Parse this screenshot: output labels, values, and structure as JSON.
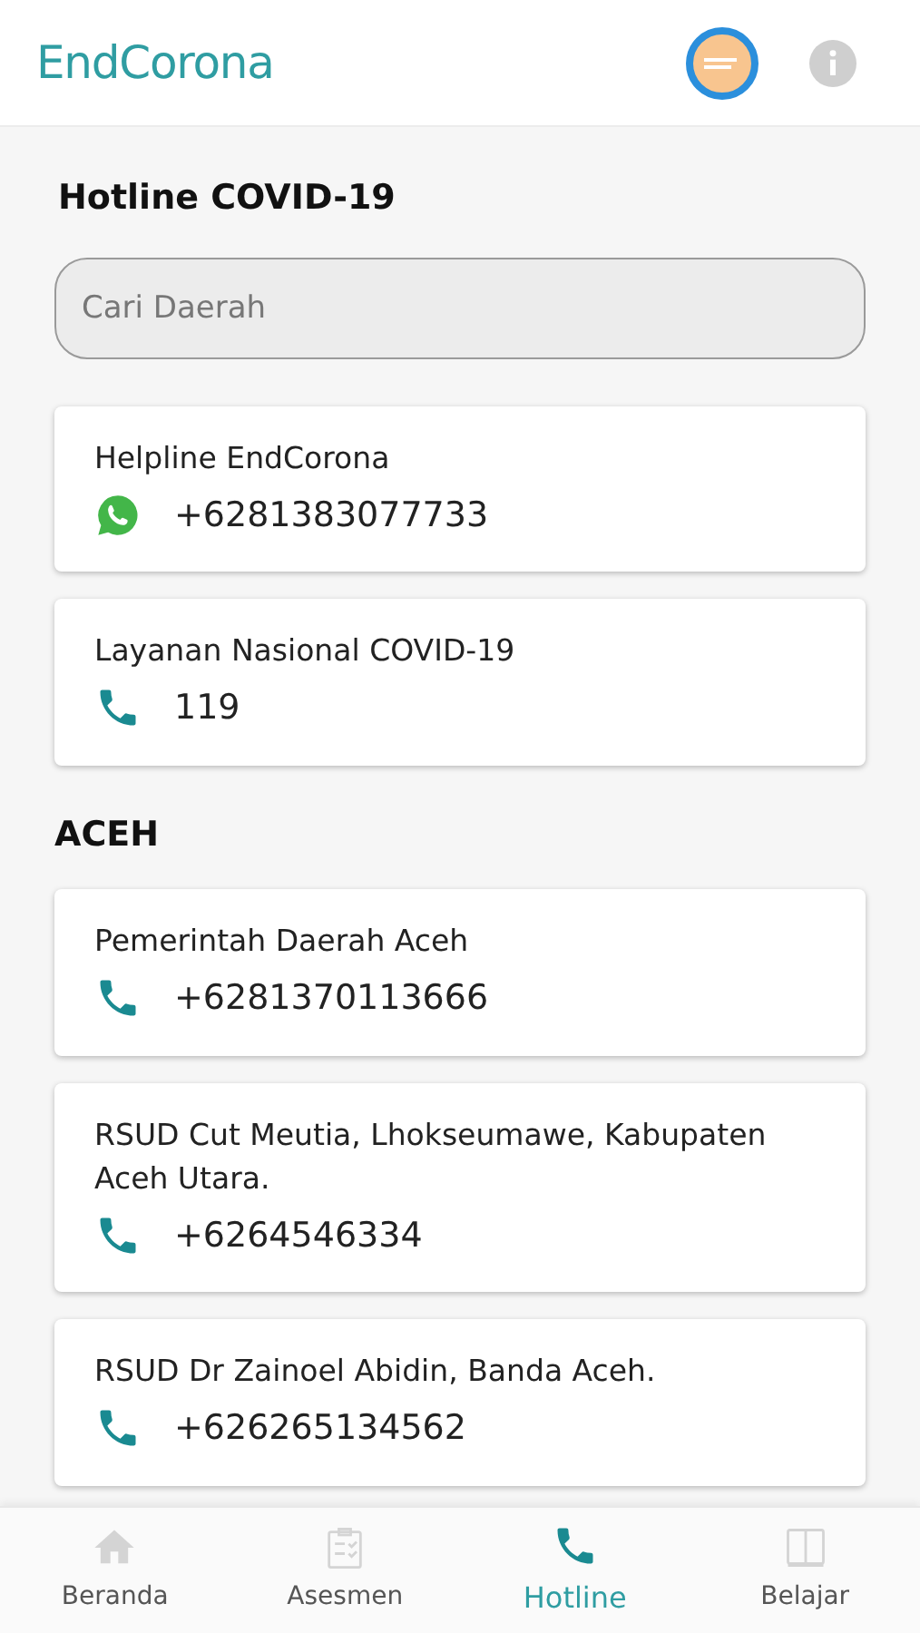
{
  "app_title": "EndCorona",
  "page_title": "Hotline COVID-19",
  "search": {
    "placeholder": "Cari Daerah"
  },
  "sections": [
    {
      "contacts": [
        {
          "name": "Helpline EndCorona",
          "kind": "whatsapp",
          "number": "+6281383077733"
        },
        {
          "name": "Layanan Nasional COVID-19",
          "kind": "phone",
          "number": "119"
        }
      ]
    },
    {
      "title": "ACEH",
      "contacts": [
        {
          "name": "Pemerintah Daerah Aceh",
          "kind": "phone",
          "number": "+6281370113666"
        },
        {
          "name": "RSUD Cut Meutia, Lhokseumawe, Kabupaten Aceh Utara.",
          "kind": "phone",
          "number": "+6264546334"
        },
        {
          "name": "RSUD Dr Zainoel Abidin, Banda Aceh.",
          "kind": "phone",
          "number": "+626265134562"
        }
      ]
    }
  ],
  "nav": [
    {
      "label": "Beranda",
      "kind": "home",
      "selected": false
    },
    {
      "label": "Asesmen",
      "kind": "clipboard",
      "selected": false
    },
    {
      "label": "Hotline",
      "kind": "phone",
      "selected": true
    },
    {
      "label": "Belajar",
      "kind": "book",
      "selected": false
    }
  ]
}
